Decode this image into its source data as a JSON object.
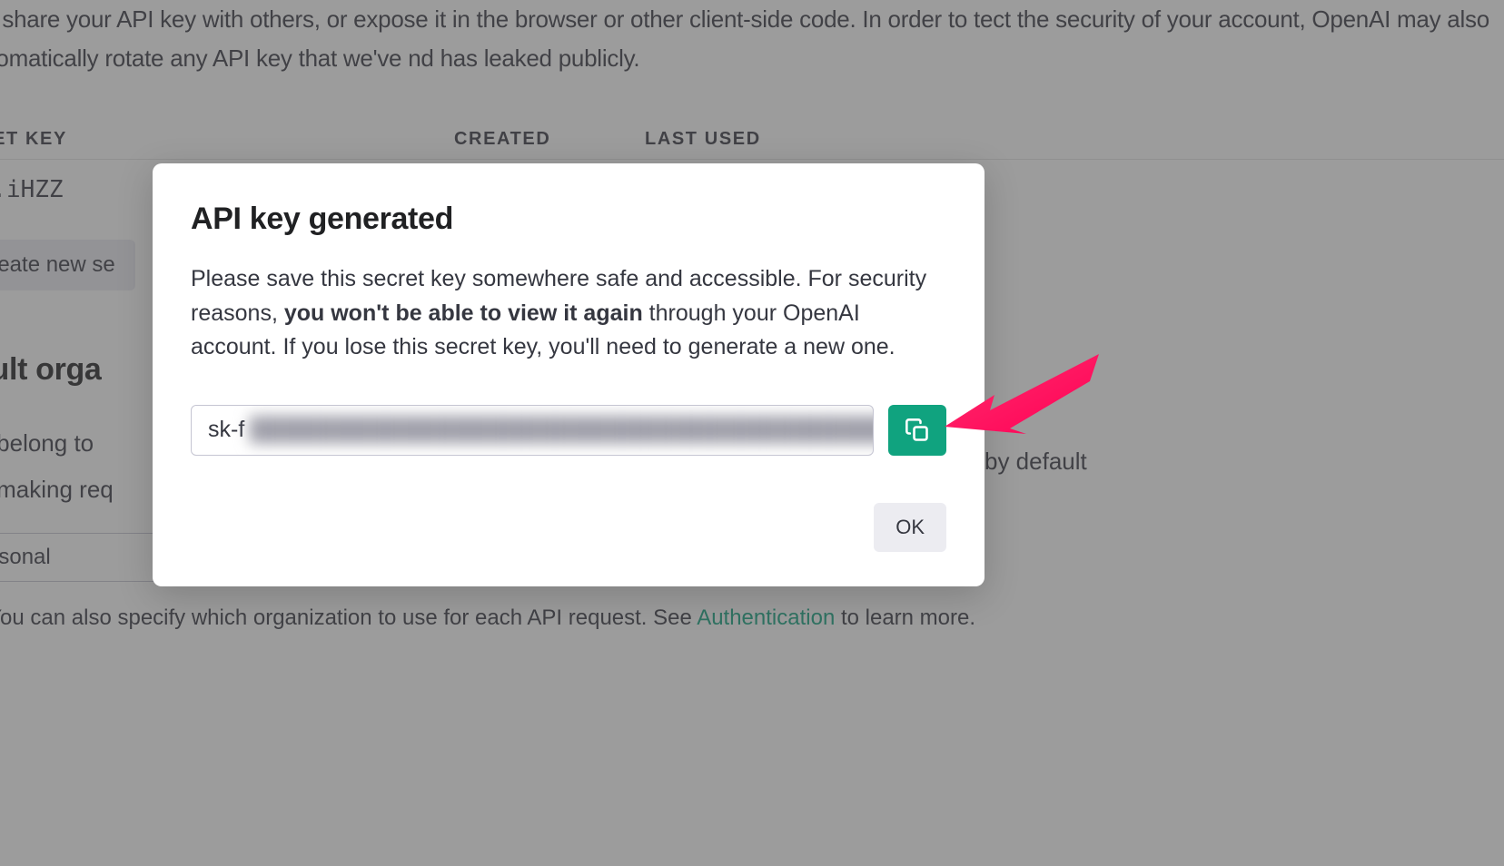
{
  "background": {
    "intro_text": "not share your API key with others, or expose it in the browser or other client-side code. In order to tect the security of your account, OpenAI may also automatically rotate any API key that we've nd has leaked publicly.",
    "table_headers": {
      "secret": "CRET KEY",
      "created": "CREATED",
      "last_used": "LAST USED"
    },
    "existing_key_masked": "...iHZZ",
    "create_button_label": "Create new se",
    "default_org_heading": "fault orga",
    "belong_line_left": "ou belong to",
    "belong_line_right": "by default",
    "making_req_line": "en making req",
    "select_value": "ersonal",
    "note_prefix": "e: You can also specify which organization to use for each API request. See ",
    "note_link": "Authentication",
    "note_suffix": " to learn more."
  },
  "modal": {
    "title": "API key generated",
    "body_before_bold": "Please save this secret key somewhere safe and accessible. For security reasons, ",
    "body_bold": "you won't be able to view it again",
    "body_after_bold": " through your OpenAI account. If you lose this secret key, you'll need to generate a new one.",
    "key_prefix": "sk-f",
    "key_obscured": "████████████████████████████████████████████████",
    "ok_label": "OK"
  },
  "colors": {
    "accent": "#10a37f",
    "annotation_arrow": "#ff2e6e"
  }
}
